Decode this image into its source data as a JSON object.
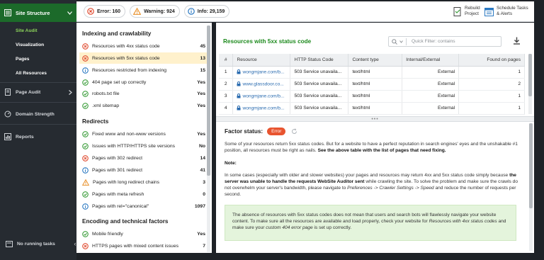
{
  "sidebar": {
    "site_structure": "Site Structure",
    "site_audit": "Site Audit",
    "visualization": "Visualization",
    "pages": "Pages",
    "all_resources": "All Resources",
    "page_audit": "Page Audit",
    "domain_strength": "Domain Strength",
    "reports": "Reports",
    "no_running_tasks": "No running tasks"
  },
  "topbar": {
    "error_label": "Error: 160",
    "warning_label": "Warning: 924",
    "info_label": "Info: 29,159",
    "rebuild_line1": "Rebuild",
    "rebuild_line2": "Project",
    "schedule_line1": "Schedule Tasks",
    "schedule_line2": "& Alerts"
  },
  "issues": {
    "sections": [
      {
        "title": "Indexing and crawlability",
        "items": [
          {
            "label": "Resources with 4xx status code",
            "count": "45",
            "status": "error"
          },
          {
            "label": "Resources with 5xx status code",
            "count": "13",
            "status": "error"
          },
          {
            "label": "Resources restricted from indexing",
            "count": "15",
            "status": "info"
          },
          {
            "label": "404 page set up correctly",
            "count": "Yes",
            "status": "ok"
          },
          {
            "label": "robots.txt file",
            "count": "Yes",
            "status": "ok"
          },
          {
            "label": ".xml sitemap",
            "count": "Yes",
            "status": "ok"
          }
        ]
      },
      {
        "title": "Redirects",
        "items": [
          {
            "label": "Fixed www and non-www versions",
            "count": "Yes",
            "status": "ok"
          },
          {
            "label": "Issues with HTTP/HTTPS site versions",
            "count": "No",
            "status": "ok"
          },
          {
            "label": "Pages with 302 redirect",
            "count": "14",
            "status": "error"
          },
          {
            "label": "Pages with 301 redirect",
            "count": "41",
            "status": "info"
          },
          {
            "label": "Pages with long redirect chains",
            "count": "3",
            "status": "warning"
          },
          {
            "label": "Pages with meta refresh",
            "count": "0",
            "status": "ok"
          },
          {
            "label": "Pages with rel=\"canonical\"",
            "count": "1097",
            "status": "info"
          }
        ]
      },
      {
        "title": "Encoding and technical factors",
        "items": [
          {
            "label": "Mobile friendly",
            "count": "Yes",
            "status": "ok"
          },
          {
            "label": "HTTPS pages with mixed content issues",
            "count": "7",
            "status": "error"
          }
        ]
      }
    ]
  },
  "main": {
    "title": "Resources with 5xx status code",
    "filter_placeholder": "Quick Filter: contains",
    "columns": [
      "#",
      "Resource",
      "HTTP Status Code",
      "Content type",
      "Internal/External",
      "Found on pages"
    ],
    "rows": [
      {
        "n": "1",
        "resource": "wongmjane.com/b...",
        "status": "503 Service unavaila...",
        "ctype": "text/html",
        "ie": "External",
        "found": "1"
      },
      {
        "n": "2",
        "resource": "www.glassdoor.co...",
        "status": "503 Service unavaila...",
        "ctype": "text/html",
        "ie": "External",
        "found": "2"
      },
      {
        "n": "3",
        "resource": "wongmjane.com/b...",
        "status": "503 Service unavaila...",
        "ctype": "text/html",
        "ie": "External",
        "found": "1"
      },
      {
        "n": "4",
        "resource": "wongmjane.com/b...",
        "status": "503 Service unavaila...",
        "ctype": "text/html",
        "ie": "External",
        "found": "1"
      }
    ],
    "splitter_dots": "•••",
    "factor_label": "Factor status:",
    "factor_badge": "Error",
    "para1_a": "Some of your resources return 5xx status codes. But for a website to have a perfect reputation in search engines' eyes and the unshakable #1 position, all resources must be right as nails.",
    "para1_b": "See the above table with the list of pages that need fixing.",
    "note_title": "Note:",
    "para2_a": "In some cases (especially with older and slower websites) your pages and resources may return 4xx and 5xx status code simply because",
    "para2_b": "the server was unable to handle the requests WebSite Auditor sent",
    "para2_c": "while crawling the site. To solve the problem and make sure the crawls do not overwhelm your server's bandwidth, please navigate to",
    "para2_d": "Preferences -> Crawler Settings -> Speed",
    "para2_e": "and reduce the number of requests per second.",
    "green_a": "The absence of resources with 5xx status codes does not mean that users and search bots will flawlessly navigate your website content. To make sure all the resources are available and load properly, check your website for",
    "green_b": "Resources with 4xx status codes",
    "green_c": "and make sure your",
    "green_d": "custom 404 error page",
    "green_e": "is set up correctly."
  }
}
